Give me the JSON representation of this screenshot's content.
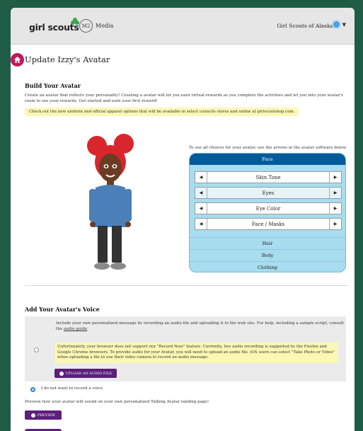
{
  "header": {
    "logo_text": "girl scouts",
    "my_media_badge": "M2",
    "my_media_label": "Media",
    "council_name": "Girl Scouts of Alaska",
    "user_initials": ""
  },
  "page": {
    "title": "Update Izzy's Avatar"
  },
  "build": {
    "heading": "Build Your Avatar",
    "intro": "Create an avatar that reflects your personality! Creating a avatar will let you earn virtual rewards as you complete the activities and let you into your avatar's room to see your rewards. Get started and earn your first reward!",
    "note": "Check out the new uniform and official apparel options that will be available in select councils stores and online at girlscoutshop.com."
  },
  "editor": {
    "instructions": "To see all choices for your avatar, use the arrows in the avatar software below.",
    "active_tab": "Face",
    "options": [
      "Skin Tone",
      "Eyes",
      "Eye Color",
      "Face / Masks"
    ],
    "selected_option": "Eyes",
    "categories": [
      "Hair",
      "Body",
      "Clothing"
    ]
  },
  "voice": {
    "heading": "Add Your Avatar's Voice",
    "upload_text": "Include your own personalized message by recording an audio file and uploading it to the web site. For help, including a sample script, consult the",
    "upload_link": "audio guide",
    "warning": "Unfortunately, your browser does not support our \"Record Now\" feature. Currently, live audio recording is supported by the Firefox and Google Chrome browsers. To provide audio for your Avatar, you will need to upload an audio file. iOS users can select \"Take Photo or Video\" when uploading a file to use their video camera to record an audio message.",
    "upload_button": "UPLOAD AN AUDIO FILE",
    "no_voice_label": "I do not want to record a voice",
    "preview_text": "Preview how your avatar will sound on your own personalized Talking Avatar landing page!",
    "preview_button": "PREVIEW"
  },
  "colors": {
    "background": "#1f5c46",
    "accent_purple": "#5c1f7c",
    "face_tab": "#005a9c",
    "panel": "#a8dcef",
    "note_yellow": "#fbf7b4",
    "home_pink": "#c2185b"
  },
  "icons": [
    "clover-icon",
    "home-icon",
    "avatar-icon",
    "chevron-down-icon",
    "arrow-left-icon",
    "arrow-right-icon",
    "upload-icon",
    "play-icon"
  ]
}
